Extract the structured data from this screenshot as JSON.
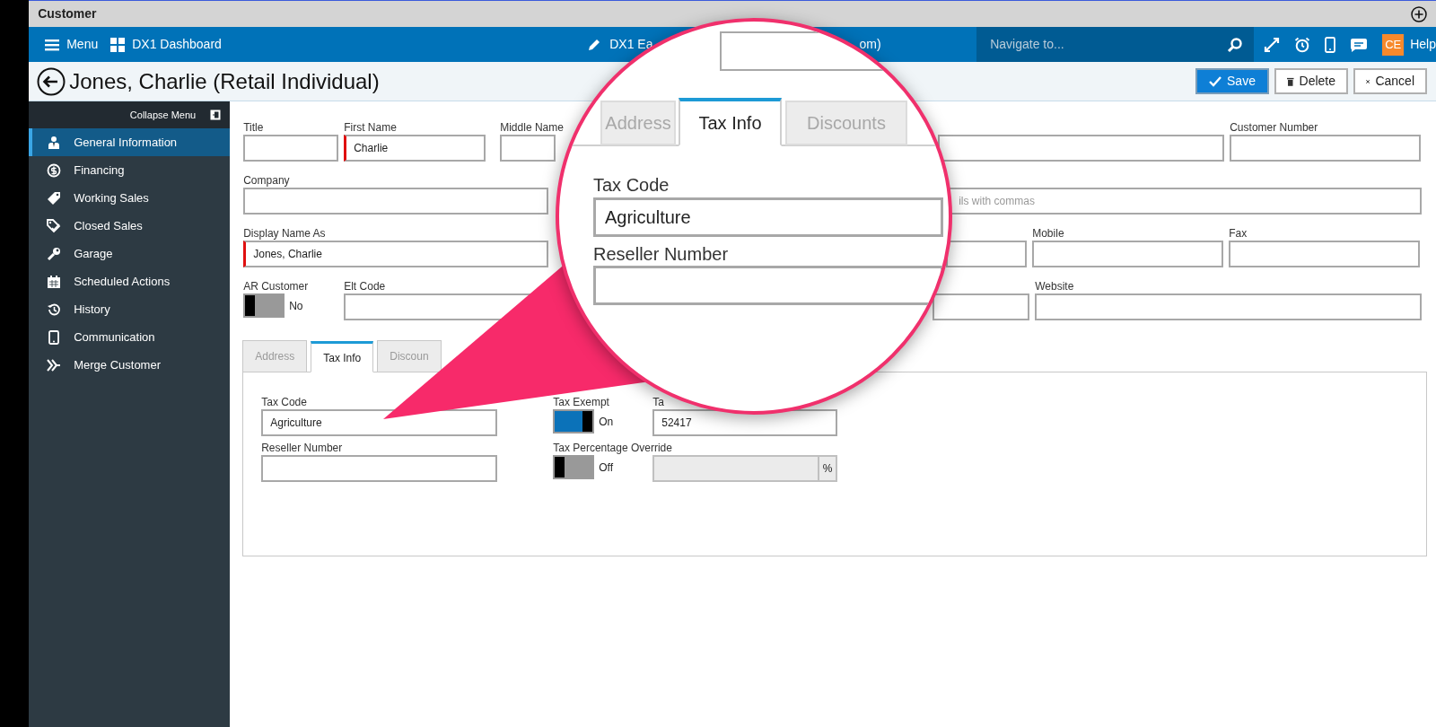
{
  "window": {
    "title": "Customer"
  },
  "nav": {
    "menu": "Menu",
    "dashboard": "DX1 Dashboard",
    "center_text": "DX1 Ea",
    "center_text_end": "om)",
    "search": {
      "placeholder": "Navigate to..."
    },
    "avatar": "CE",
    "help": "Help"
  },
  "header": {
    "title": "Jones, Charlie (Retail Individual)",
    "buttons": [
      {
        "label": "Save",
        "kind": "primary"
      },
      {
        "label": "Delete",
        "kind": "delete"
      },
      {
        "label": "Cancel",
        "kind": "cancel"
      }
    ]
  },
  "sidebar": {
    "collapse": "Collapse Menu",
    "items": [
      {
        "label": "General Information",
        "selected": true
      },
      {
        "label": "Financing",
        "selected": false
      },
      {
        "label": "Working Sales",
        "selected": false
      },
      {
        "label": "Closed Sales",
        "selected": false
      },
      {
        "label": "Garage",
        "selected": false
      },
      {
        "label": "Scheduled Actions",
        "selected": false
      },
      {
        "label": "History",
        "selected": false
      },
      {
        "label": "Communication",
        "selected": false
      },
      {
        "label": "Merge Customer",
        "selected": false
      }
    ]
  },
  "form": {
    "title": {
      "label": "Title",
      "required": false
    },
    "first_name": {
      "label": "First Name",
      "value": "Charlie",
      "required": true
    },
    "middle_name": {
      "label": "Middle Name",
      "required": false
    },
    "customer_number": {
      "label": "Customer Number",
      "required": false
    },
    "company": {
      "label": "Company",
      "required": false
    },
    "emails": {
      "placeholder": "ils with commas",
      "required": false
    },
    "display_name": {
      "label": "Display Name As",
      "value": "Jones, Charlie",
      "required": true
    },
    "mobile": {
      "label": "Mobile",
      "required": false
    },
    "fax": {
      "label": "Fax",
      "required": false
    },
    "ar_customer": {
      "label": "AR Customer",
      "on": false,
      "state_text": "No"
    },
    "elt_code": {
      "label": "Elt Code",
      "required": false
    },
    "website": {
      "label": "Website",
      "required": false
    }
  },
  "tabs": [
    {
      "label": "Address",
      "selected": false
    },
    {
      "label": "Tax Info",
      "selected": true
    },
    {
      "label": "Discoun",
      "selected": false
    }
  ],
  "tax": {
    "tax_code": {
      "label": "Tax Code",
      "value": "Agriculture"
    },
    "reseller": {
      "label": "Reseller Number"
    },
    "tax_exempt": {
      "label": "Tax Exempt",
      "on": true,
      "state_text": "On"
    },
    "tax_id": {
      "label": "Ta",
      "value": "52417"
    },
    "override": {
      "label": "Tax Percentage Override",
      "on": false,
      "state_text": "Off"
    },
    "percent": {
      "unit": "%",
      "disabled": true
    }
  },
  "magnifier": {
    "tabs": [
      {
        "label": "Address",
        "selected": false
      },
      {
        "label": "Tax Info",
        "selected": true
      },
      {
        "label": "Discounts",
        "selected": false
      }
    ],
    "tax_code": {
      "label": "Tax Code",
      "value": "Agriculture"
    },
    "reseller": {
      "label": "Reseller Number"
    }
  }
}
